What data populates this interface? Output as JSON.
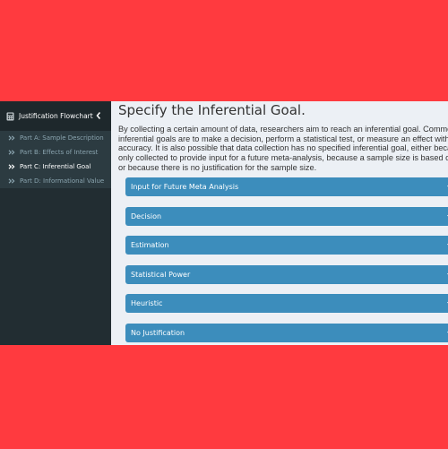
{
  "sidebar": {
    "header": {
      "title": "Justification Flowchart",
      "icon": "calculator-icon",
      "toggle_icon": "chevron-left-icon"
    },
    "items": [
      {
        "label": "Part A: Sample Description",
        "icon": "double-chevron-right-icon",
        "active": false
      },
      {
        "label": "Part B: Effects of Interest",
        "icon": "double-chevron-right-icon",
        "active": false
      },
      {
        "label": "Part C: Inferential Goal",
        "icon": "double-chevron-right-icon",
        "active": true
      },
      {
        "label": "Part D: Informational Value",
        "icon": "double-chevron-right-icon",
        "active": false
      }
    ]
  },
  "main": {
    "title": "Specify the Inferential Goal.",
    "intro": "By collecting a certain amount of data, researchers aim to reach an inferential goal. Commonly inferential goals are to make a decision, perform a statistical test, or measure an effect with a desired accuracy. It is also possible that data collection has no specified inferential goal, either because data is only collected to provide input for a future meta-analysis, because a sample size is based on heuristics, or because there is no justification for the sample size.",
    "accordion": [
      {
        "label": "Input for Future Meta Analysis",
        "icon": "caret-down-icon"
      },
      {
        "label": "Decision",
        "icon": "caret-down-icon"
      },
      {
        "label": "Estimation",
        "icon": "caret-down-icon"
      },
      {
        "label": "Statistical Power",
        "icon": "caret-down-icon"
      },
      {
        "label": "Heuristic",
        "icon": "caret-down-icon"
      },
      {
        "label": "No Justification",
        "icon": "caret-down-icon"
      }
    ]
  },
  "colors": {
    "background": "#ff3a3f",
    "sidebar": "#222d32",
    "sidebar_submenu": "#2c3b41",
    "content": "#ecf0f5",
    "accordion": "#3c8dbc"
  }
}
